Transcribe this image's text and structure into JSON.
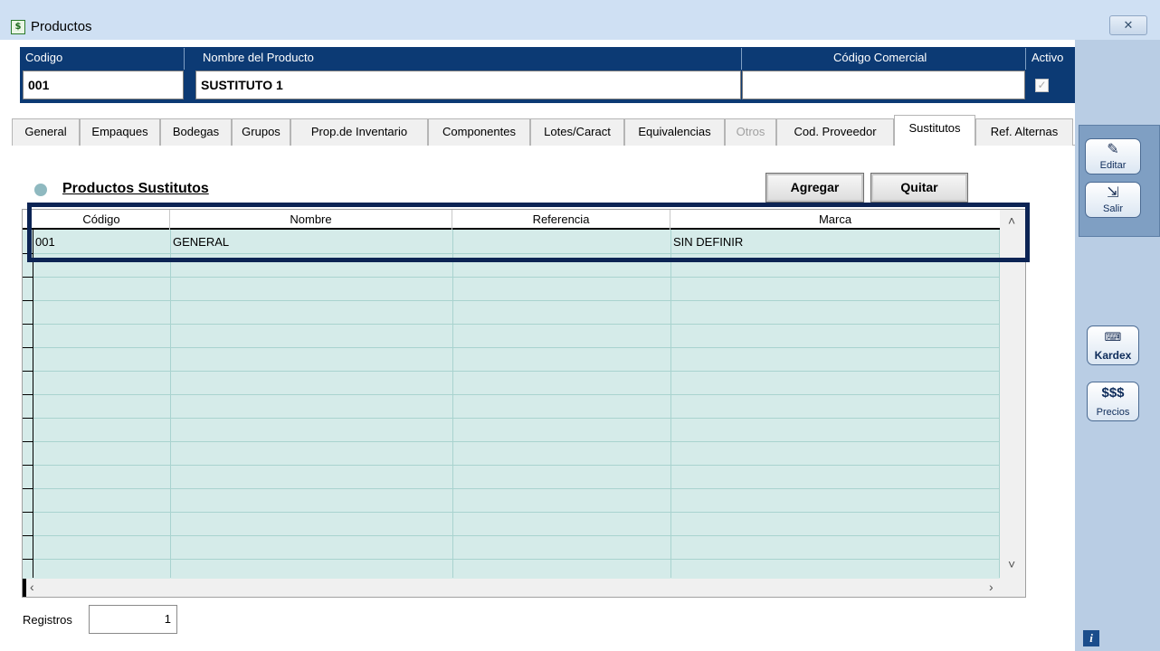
{
  "window": {
    "title": "Productos",
    "close_glyph": "✕"
  },
  "header": {
    "labels": {
      "codigo": "Codigo",
      "nombre": "Nombre del Producto",
      "codigo_comercial": "Código Comercial",
      "activo": "Activo"
    },
    "values": {
      "codigo": "001",
      "nombre": "SUSTITUTO 1",
      "codigo_comercial": "",
      "activo": true
    }
  },
  "tabs": [
    {
      "label": "General",
      "state": "normal"
    },
    {
      "label": "Empaques",
      "state": "normal"
    },
    {
      "label": "Bodegas",
      "state": "normal"
    },
    {
      "label": "Grupos",
      "state": "normal"
    },
    {
      "label": "Prop.de Inventario",
      "state": "normal"
    },
    {
      "label": "Componentes",
      "state": "normal"
    },
    {
      "label": "Lotes/Caract",
      "state": "normal"
    },
    {
      "label": "Equivalencias",
      "state": "normal"
    },
    {
      "label": "Otros",
      "state": "disabled"
    },
    {
      "label": "Cod. Proveedor",
      "state": "normal"
    },
    {
      "label": "Sustitutos",
      "state": "active"
    },
    {
      "label": "Ref. Alternas",
      "state": "normal"
    }
  ],
  "section": {
    "title": "Productos Sustitutos"
  },
  "buttons": {
    "agregar": "Agregar",
    "quitar": "Quitar"
  },
  "grid": {
    "columns": [
      "Código",
      "Nombre",
      "Referencia",
      "Marca"
    ],
    "rows": [
      {
        "codigo": "001",
        "nombre": "GENERAL",
        "referencia": "",
        "marca": "SIN DEFINIR"
      }
    ]
  },
  "footer": {
    "registros_label": "Registros",
    "registros_value": "1"
  },
  "sidebar": {
    "editar": "Editar",
    "salir": "Salir",
    "kardex": "Kardex",
    "precios_symbol": "$$$",
    "precios": "Precios",
    "info": "i"
  },
  "colors": {
    "header_bg": "#0c3a74",
    "grid_bg": "#d5ebe9",
    "sidebar_bg": "#b9cde4",
    "highlight": "#0c2454"
  },
  "icons": [
    "product-icon",
    "close-icon",
    "edit-icon",
    "exit-icon",
    "keyboard-icon",
    "info-icon",
    "scroll-up-icon",
    "scroll-down-icon",
    "scroll-left-icon",
    "scroll-right-icon"
  ]
}
